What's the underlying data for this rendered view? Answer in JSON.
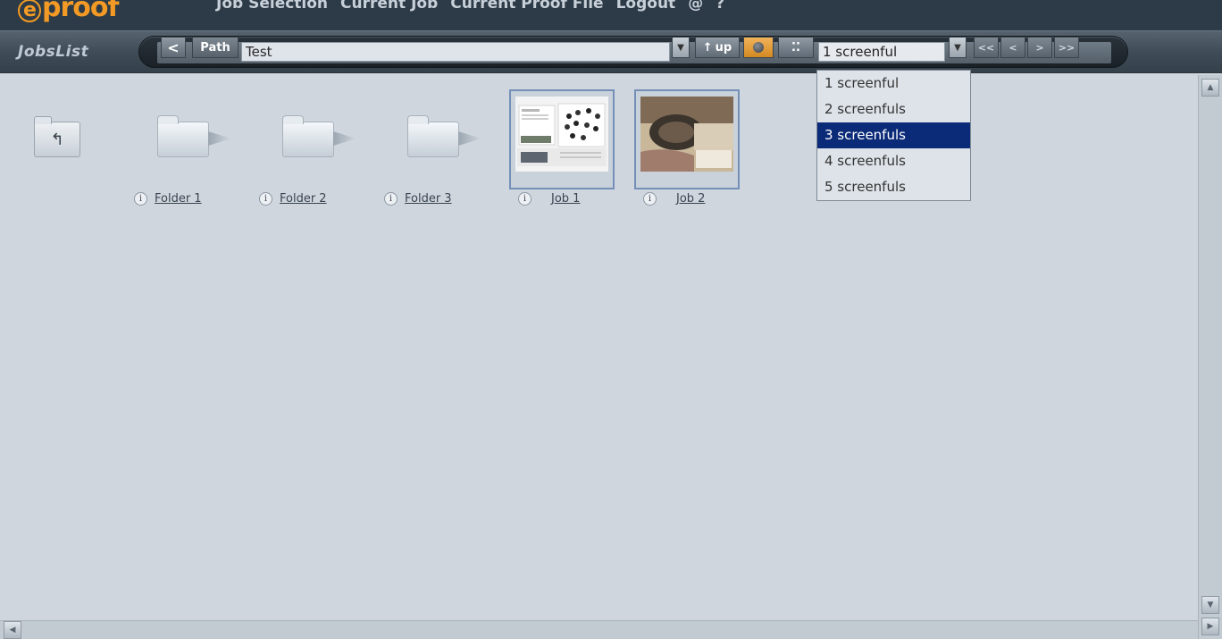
{
  "header": {
    "logo": "proof",
    "nav": [
      "Job Selection",
      "Current Job",
      "Current Proof File",
      "Logout",
      "@",
      "?"
    ]
  },
  "toolbar": {
    "title": "JobsList",
    "back_label": "<",
    "path_label": "Path",
    "path_value": "Test",
    "up_label": "up",
    "screens_value": "1 screenful",
    "pager": [
      "<<",
      "<",
      ">",
      ">>"
    ]
  },
  "dropdown": {
    "options": [
      "1 screenful",
      "2 screenfuls",
      "3 screenfuls",
      "4 screenfuls",
      "5 screenfuls"
    ],
    "highlighted_index": 2
  },
  "items": [
    {
      "label": "Folder 1",
      "type": "folder"
    },
    {
      "label": "Folder 2",
      "type": "folder"
    },
    {
      "label": "Folder 3",
      "type": "folder"
    },
    {
      "label": "Job 1",
      "type": "job"
    },
    {
      "label": "Job 2",
      "type": "job"
    }
  ],
  "colors": {
    "accent_orange": "#f29a25",
    "highlight_blue": "#0b2a78",
    "topbar": "#2c3b47",
    "content_bg": "#cfd6de"
  }
}
